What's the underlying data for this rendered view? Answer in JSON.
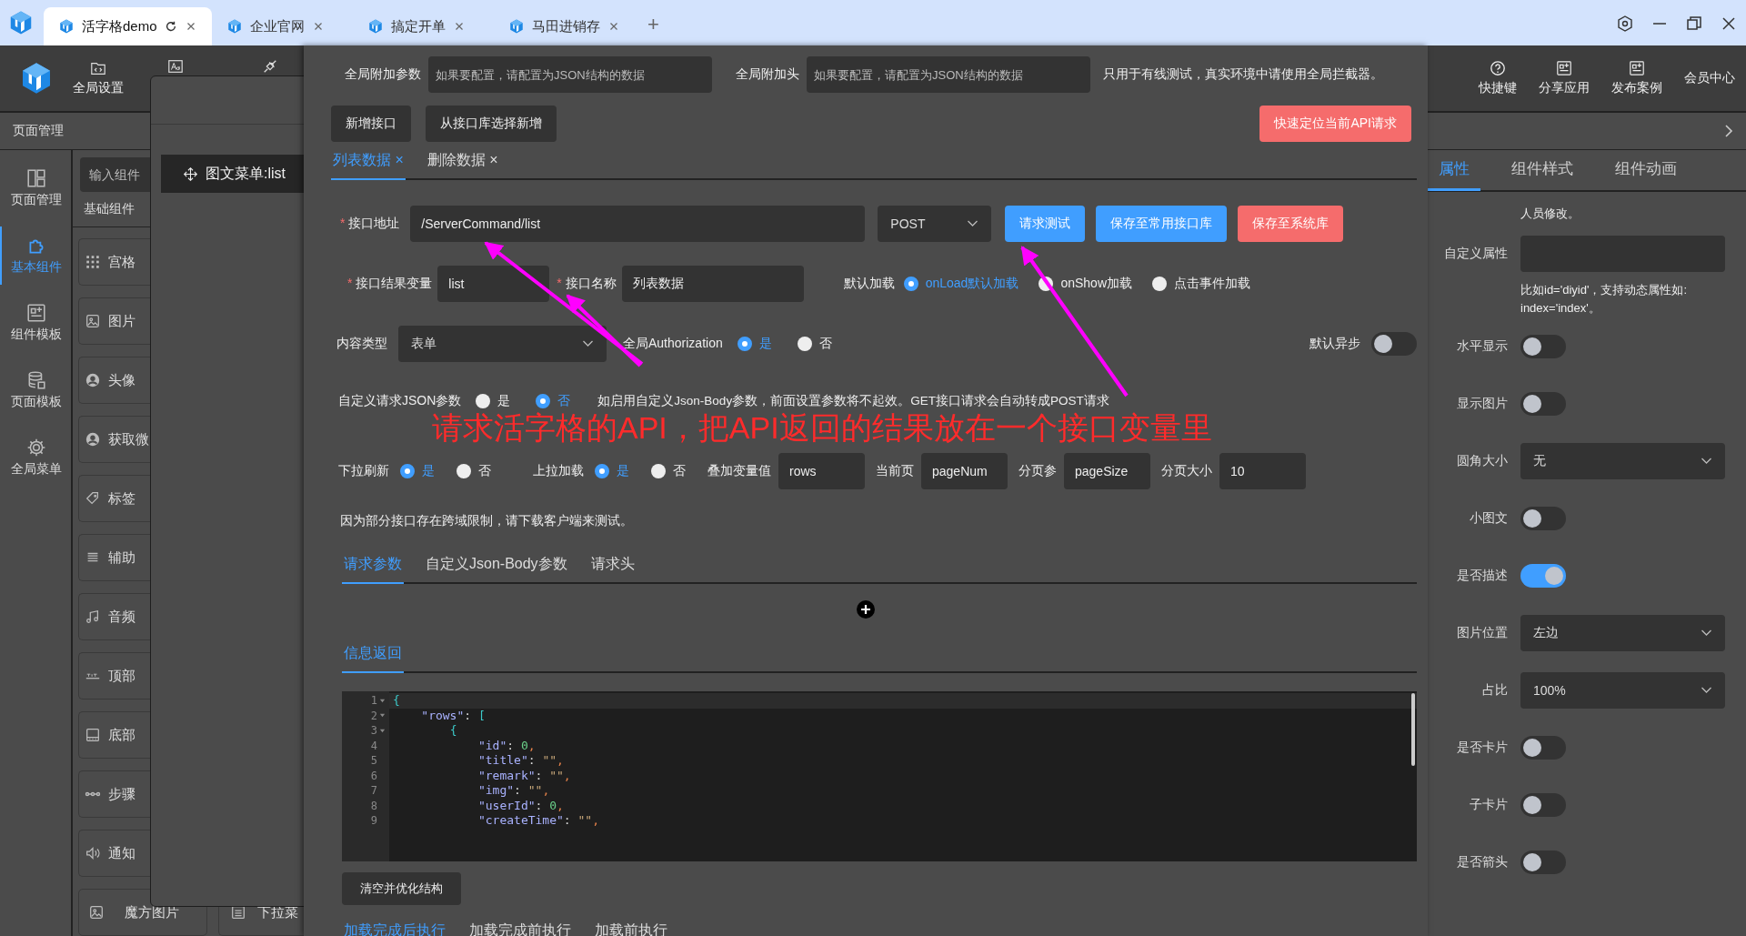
{
  "browser": {
    "tabs": [
      {
        "title": "活字格demo",
        "selected": true
      },
      {
        "title": "企业官网",
        "selected": false
      },
      {
        "title": "搞定开单",
        "selected": false
      },
      {
        "title": "马田进销存",
        "selected": false
      }
    ],
    "new_tab": "+"
  },
  "header": {
    "tools": [
      {
        "kind": "settings",
        "label": "全局设置"
      },
      {
        "kind": "font"
      },
      {
        "kind": "plug"
      }
    ],
    "right_tools": [
      {
        "kind": "help",
        "label": "快捷键"
      },
      {
        "kind": "board",
        "label": "分享应用"
      },
      {
        "kind": "board",
        "label": "发布案例"
      },
      {
        "kind": "text",
        "label": "会员中心"
      }
    ]
  },
  "page_bar": {
    "title": "页面管理"
  },
  "nav": [
    {
      "label": "页面管理",
      "selected": false
    },
    {
      "label": "基本组件",
      "selected": true
    },
    {
      "label": "组件模板",
      "selected": false
    },
    {
      "label": "页面模板",
      "selected": false
    },
    {
      "label": "全局菜单",
      "selected": false
    }
  ],
  "components": {
    "search_placeholder": "输入组件",
    "heading": "基础组件",
    "items": [
      "宫格",
      "图片",
      "头像",
      "获取微",
      "标签",
      "辅助",
      "音频",
      "顶部",
      "底部",
      "步骤",
      "通知"
    ],
    "bottom_items": [
      "魔方图片",
      "下拉菜"
    ]
  },
  "canvas": {
    "item": "图文菜单:list"
  },
  "dialog": {
    "global_params": {
      "label": "全局附加参数",
      "placeholder": "如果要配置，请配置为JSON结构的数据"
    },
    "global_headers": {
      "label": "全局附加头",
      "placeholder": "如果要配置，请配置为JSON结构的数据"
    },
    "global_note": "只用于有线测试，真实环境中请使用全局拦截器。",
    "buttons": [
      "新增接口",
      "从接口库选择新增"
    ],
    "locate_button": "快速定位当前API请求",
    "api_tabs": [
      {
        "label": "列表数据",
        "close": "×",
        "selected": true
      },
      {
        "label": "删除数据",
        "close": "×",
        "selected": false
      }
    ],
    "url": {
      "required": "*",
      "label": "接口地址",
      "value": "/ServerCommand/list"
    },
    "method": "POST",
    "actions": [
      {
        "label": "请求测试",
        "kind": "primary"
      },
      {
        "label": "保存至常用接口库",
        "kind": "primary"
      },
      {
        "label": "保存至系统库",
        "kind": "danger"
      }
    ],
    "result_var": {
      "required": "*",
      "label": "接口结果变量",
      "value": "list"
    },
    "api_name": {
      "required": "*",
      "label": "接口名称",
      "value": "列表数据"
    },
    "default_load": {
      "label": "默认加载",
      "options": [
        {
          "label": "onLoad默认加载",
          "selected": true
        },
        {
          "label": "onShow加载",
          "selected": false
        },
        {
          "label": "点击事件加载",
          "selected": false
        }
      ]
    },
    "content_type": {
      "label": "内容类型",
      "value": "表单"
    },
    "authorization": {
      "label": "全局Authorization",
      "options": [
        {
          "label": "是",
          "selected": true
        },
        {
          "label": "否",
          "selected": false
        }
      ]
    },
    "default_async": {
      "label": "默认异步",
      "on": false
    },
    "custom_json": {
      "label": "自定义请求JSON参数",
      "options": [
        {
          "label": "是",
          "selected": false
        },
        {
          "label": "否",
          "selected": true
        }
      ],
      "note": "如启用自定义Json-Body参数，前面设置参数将不起效。GET接口请求会自动转成POST请求"
    },
    "annotation": "请求活字格的API，把API返回的结果放在一个接口变量里",
    "pull_refresh": {
      "label": "下拉刷新",
      "options": [
        {
          "label": "是",
          "selected": true
        },
        {
          "label": "否",
          "selected": false
        }
      ]
    },
    "pull_load": {
      "label": "上拉加载",
      "options": [
        {
          "label": "是",
          "selected": true
        },
        {
          "label": "否",
          "selected": false
        }
      ]
    },
    "paging": [
      {
        "label": "叠加变量值",
        "value": "rows"
      },
      {
        "label": "当前页",
        "value": "pageNum"
      },
      {
        "label": "分页参",
        "value": "pageSize"
      },
      {
        "label": "分页大小",
        "value": "10"
      }
    ],
    "cors_note": "因为部分接口存在跨域限制，请下载客户端来测试。",
    "request_tabs": [
      {
        "label": "请求参数",
        "selected": true
      },
      {
        "label": "自定义Json-Body参数",
        "selected": false
      },
      {
        "label": "请求头",
        "selected": false
      }
    ],
    "response_tab": {
      "label": "信息返回",
      "selected": true
    },
    "code": [
      {
        "n": "1",
        "text": "{",
        "expanded": true
      },
      {
        "n": "2",
        "text": "    \"rows\": [",
        "expanded": true
      },
      {
        "n": "3",
        "text": "        {",
        "expanded": true
      },
      {
        "n": "4",
        "text": "            \"id\": 0,",
        "expanded": false
      },
      {
        "n": "5",
        "text": "            \"title\": \"\",",
        "expanded": false
      },
      {
        "n": "6",
        "text": "            \"remark\": \"\",",
        "expanded": false
      },
      {
        "n": "7",
        "text": "            \"img\": \"\",",
        "expanded": false
      },
      {
        "n": "8",
        "text": "            \"userId\": 0,",
        "expanded": false
      },
      {
        "n": "9",
        "text": "            \"createTime\": \"\",",
        "expanded": false
      }
    ],
    "clear_button": "清空并优化结构",
    "event_tabs": [
      {
        "label": "加载完成后执行",
        "selected": true
      },
      {
        "label": "加载完成前执行",
        "selected": false
      },
      {
        "label": "加载前执行",
        "selected": false
      }
    ]
  },
  "props": {
    "tabs": [
      {
        "label": "属性",
        "selected": true
      },
      {
        "label": "组件样式",
        "selected": false
      },
      {
        "label": "组件动画",
        "selected": false
      }
    ],
    "note": "人员修改。",
    "custom_attr": {
      "label": "自定义属性",
      "hint": "比如id='diyid'，支持动态属性如: index='index'。"
    },
    "rows": [
      {
        "label": "水平显示",
        "kind": "toggle",
        "on": false
      },
      {
        "label": "显示图片",
        "kind": "toggle",
        "on": false
      },
      {
        "label": "圆角大小",
        "kind": "select",
        "value": "无"
      },
      {
        "label": "小图文",
        "kind": "toggle",
        "on": false
      },
      {
        "label": "是否描述",
        "kind": "toggle",
        "on": true
      },
      {
        "label": "图片位置",
        "kind": "select",
        "value": "左边"
      },
      {
        "label": "占比",
        "kind": "select",
        "value": "100%"
      },
      {
        "label": "是否卡片",
        "kind": "toggle",
        "on": false
      },
      {
        "label": "子卡片",
        "kind": "toggle",
        "on": false
      },
      {
        "label": "是否箭头",
        "kind": "toggle",
        "on": false
      }
    ]
  }
}
